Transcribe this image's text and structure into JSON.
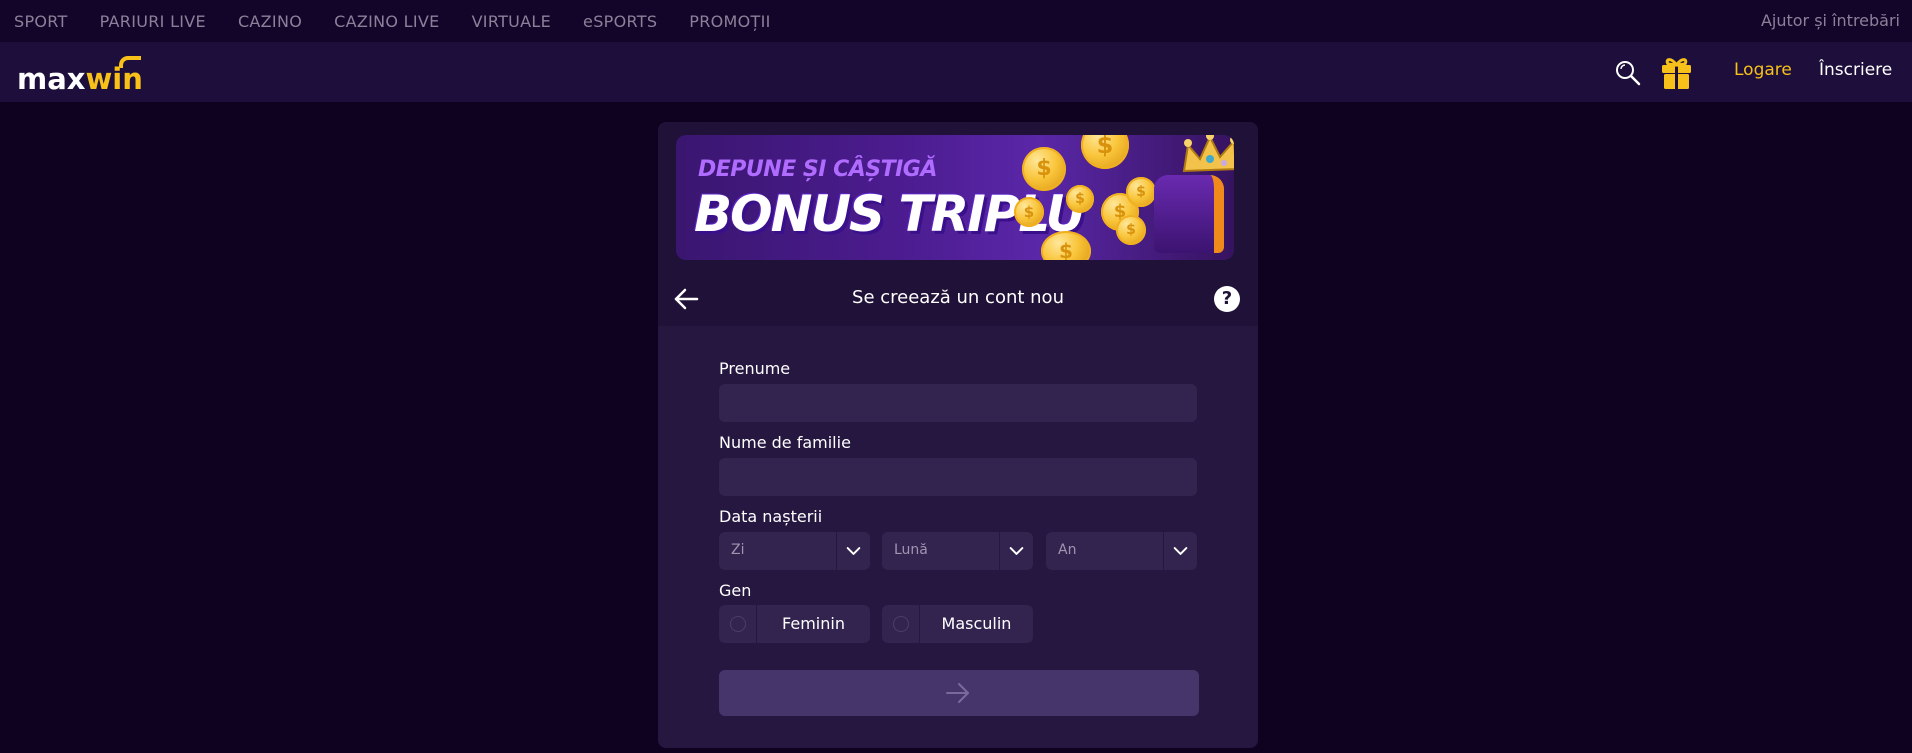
{
  "topnav": {
    "items": [
      "SPORT",
      "PARIURI LIVE",
      "CAZINO",
      "CAZINO LIVE",
      "VIRTUALE",
      "eSPORTS",
      "PROMOȚII"
    ],
    "help": "Ajutor și întrebări"
  },
  "header": {
    "logo_max": "max",
    "logo_win": "win",
    "login": "Logare",
    "register": "Înscriere",
    "icons": [
      "search-icon",
      "gift-icon"
    ]
  },
  "banner": {
    "subtitle": "DEPUNE ȘI CÂȘTIGĂ",
    "title": "BONUS TRIPLU"
  },
  "form": {
    "title": "Se creează un cont nou",
    "first_name_label": "Prenume",
    "first_name_value": "",
    "last_name_label": "Nume de familie",
    "last_name_value": "",
    "birthdate_label": "Data nașterii",
    "day_placeholder": "Zi",
    "month_placeholder": "Lună",
    "year_placeholder": "An",
    "gender_label": "Gen",
    "gender_female": "Feminin",
    "gender_male": "Masculin"
  },
  "colors": {
    "accent": "#f7c11a",
    "background": "#0f0220",
    "card": "#261741",
    "input": "#33244f",
    "submit": "#45356b"
  }
}
